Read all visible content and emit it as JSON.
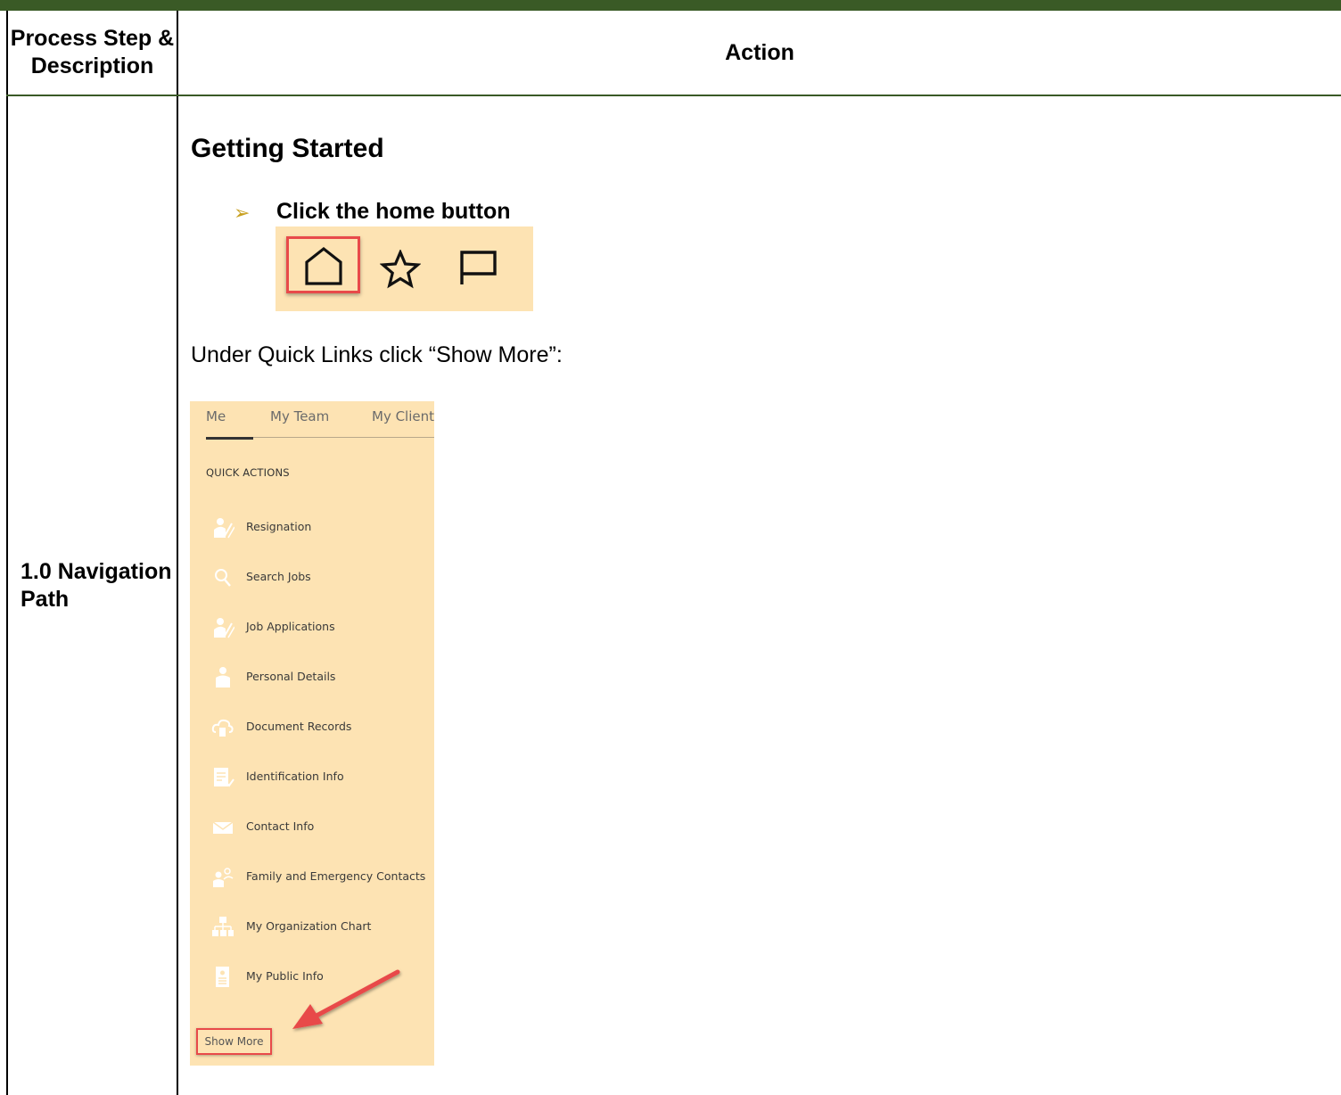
{
  "table": {
    "header_step": "Process Step & Description",
    "header_action": "Action",
    "step_label": "1.0 Navigation Path"
  },
  "content": {
    "heading": "Getting Started",
    "bullet": "Click the home button",
    "instruction": "Under Quick Links click “Show More”:"
  },
  "toolbar": {
    "icons": [
      "home-icon",
      "star-icon",
      "flag-icon"
    ],
    "highlight_color": "#e84a4a",
    "background": "#fde3b3"
  },
  "panel": {
    "tabs": [
      "Me",
      "My Team",
      "My Client"
    ],
    "active_tab": "Me",
    "section_title": "QUICK ACTIONS",
    "items": [
      {
        "label": "Resignation",
        "icon": "person-pen-icon"
      },
      {
        "label": "Search Jobs",
        "icon": "search-icon"
      },
      {
        "label": "Job Applications",
        "icon": "person-pen-icon"
      },
      {
        "label": "Personal Details",
        "icon": "person-icon"
      },
      {
        "label": "Document Records",
        "icon": "cloud-document-icon"
      },
      {
        "label": "Identification Info",
        "icon": "id-document-icon"
      },
      {
        "label": "Contact Info",
        "icon": "envelope-icon"
      },
      {
        "label": "Family and Emergency Contacts",
        "icon": "family-icon"
      },
      {
        "label": "My Organization Chart",
        "icon": "org-chart-icon"
      },
      {
        "label": "My Public Info",
        "icon": "badge-icon"
      }
    ],
    "show_more": "Show More"
  },
  "colors": {
    "header_bar": "#3a5a26",
    "panel_bg": "#fde3b3",
    "annotation_red": "#e84a4a",
    "bullet_gold": "#c8a020"
  }
}
